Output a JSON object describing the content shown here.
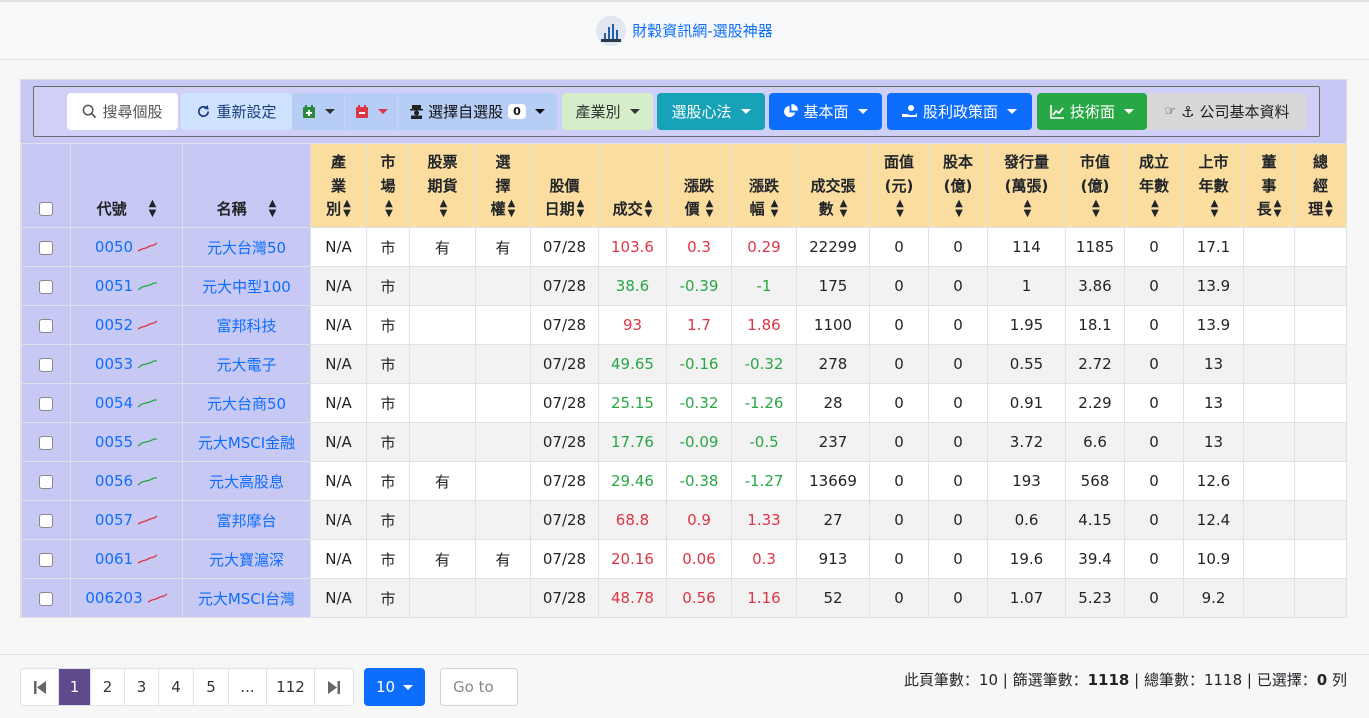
{
  "app": {
    "title": "財穀資訊網-選股神器"
  },
  "colors": {
    "accent": "#0d6efd",
    "up": "#dc3545",
    "down": "#28a745",
    "header_bg": "#fbdd9f",
    "side_bg": "#c8c8f5"
  },
  "toolbar": {
    "search": "搜尋個股",
    "reset": "重新設定",
    "select_watchlist": "選擇自選股",
    "watchlist_count": "0",
    "industry": "產業別",
    "method": "選股心法",
    "fundamentals": "基本面",
    "dividend": "股利政策面",
    "technical": "技術面",
    "company_info": "公司基本資料"
  },
  "columns": [
    {
      "key": "code",
      "label": "代號"
    },
    {
      "key": "name",
      "label": "名稱"
    },
    {
      "key": "industry",
      "label": "產業別"
    },
    {
      "key": "market",
      "label": "市場"
    },
    {
      "key": "futures",
      "label": "股票期貨"
    },
    {
      "key": "options",
      "label": "選擇權"
    },
    {
      "key": "date",
      "label": "股價日期"
    },
    {
      "key": "price",
      "label": "成交"
    },
    {
      "key": "change",
      "label": "漲跌價"
    },
    {
      "key": "pct",
      "label": "漲跌幅"
    },
    {
      "key": "volume",
      "label": "成交張數"
    },
    {
      "key": "par",
      "label": "面值(元)"
    },
    {
      "key": "capital",
      "label": "股本(億)"
    },
    {
      "key": "issued",
      "label": "發行量(萬張)"
    },
    {
      "key": "mcap",
      "label": "市值(億)"
    },
    {
      "key": "est_years",
      "label": "成立年數"
    },
    {
      "key": "list_years",
      "label": "上市年數"
    },
    {
      "key": "chair",
      "label": "董事長"
    },
    {
      "key": "gm",
      "label": "總經理"
    }
  ],
  "rows": [
    {
      "code": "0050",
      "name": "元大台灣50",
      "industry": "N/A",
      "market": "市",
      "futures": "有",
      "options": "有",
      "date": "07/28",
      "price": "103.6",
      "change": "0.3",
      "pct": "0.29",
      "volume": "22299",
      "par": "0",
      "capital": "0",
      "issued": "114",
      "mcap": "1185",
      "est_years": "0",
      "list_years": "17.1",
      "chair": "",
      "gm": "",
      "dir": "up"
    },
    {
      "code": "0051",
      "name": "元大中型100",
      "industry": "N/A",
      "market": "市",
      "futures": "",
      "options": "",
      "date": "07/28",
      "price": "38.6",
      "change": "-0.39",
      "pct": "-1",
      "volume": "175",
      "par": "0",
      "capital": "0",
      "issued": "1",
      "mcap": "3.86",
      "est_years": "0",
      "list_years": "13.9",
      "chair": "",
      "gm": "",
      "dir": "down"
    },
    {
      "code": "0052",
      "name": "富邦科技",
      "industry": "N/A",
      "market": "市",
      "futures": "",
      "options": "",
      "date": "07/28",
      "price": "93",
      "change": "1.7",
      "pct": "1.86",
      "volume": "1100",
      "par": "0",
      "capital": "0",
      "issued": "1.95",
      "mcap": "18.1",
      "est_years": "0",
      "list_years": "13.9",
      "chair": "",
      "gm": "",
      "dir": "up"
    },
    {
      "code": "0053",
      "name": "元大電子",
      "industry": "N/A",
      "market": "市",
      "futures": "",
      "options": "",
      "date": "07/28",
      "price": "49.65",
      "change": "-0.16",
      "pct": "-0.32",
      "volume": "278",
      "par": "0",
      "capital": "0",
      "issued": "0.55",
      "mcap": "2.72",
      "est_years": "0",
      "list_years": "13",
      "chair": "",
      "gm": "",
      "dir": "down"
    },
    {
      "code": "0054",
      "name": "元大台商50",
      "industry": "N/A",
      "market": "市",
      "futures": "",
      "options": "",
      "date": "07/28",
      "price": "25.15",
      "change": "-0.32",
      "pct": "-1.26",
      "volume": "28",
      "par": "0",
      "capital": "0",
      "issued": "0.91",
      "mcap": "2.29",
      "est_years": "0",
      "list_years": "13",
      "chair": "",
      "gm": "",
      "dir": "down"
    },
    {
      "code": "0055",
      "name": "元大MSCI金融",
      "industry": "N/A",
      "market": "市",
      "futures": "",
      "options": "",
      "date": "07/28",
      "price": "17.76",
      "change": "-0.09",
      "pct": "-0.5",
      "volume": "237",
      "par": "0",
      "capital": "0",
      "issued": "3.72",
      "mcap": "6.6",
      "est_years": "0",
      "list_years": "13",
      "chair": "",
      "gm": "",
      "dir": "down"
    },
    {
      "code": "0056",
      "name": "元大高股息",
      "industry": "N/A",
      "market": "市",
      "futures": "有",
      "options": "",
      "date": "07/28",
      "price": "29.46",
      "change": "-0.38",
      "pct": "-1.27",
      "volume": "13669",
      "par": "0",
      "capital": "0",
      "issued": "193",
      "mcap": "568",
      "est_years": "0",
      "list_years": "12.6",
      "chair": "",
      "gm": "",
      "dir": "down"
    },
    {
      "code": "0057",
      "name": "富邦摩台",
      "industry": "N/A",
      "market": "市",
      "futures": "",
      "options": "",
      "date": "07/28",
      "price": "68.8",
      "change": "0.9",
      "pct": "1.33",
      "volume": "27",
      "par": "0",
      "capital": "0",
      "issued": "0.6",
      "mcap": "4.15",
      "est_years": "0",
      "list_years": "12.4",
      "chair": "",
      "gm": "",
      "dir": "up"
    },
    {
      "code": "0061",
      "name": "元大寶滬深",
      "industry": "N/A",
      "market": "市",
      "futures": "有",
      "options": "有",
      "date": "07/28",
      "price": "20.16",
      "change": "0.06",
      "pct": "0.3",
      "volume": "913",
      "par": "0",
      "capital": "0",
      "issued": "19.6",
      "mcap": "39.4",
      "est_years": "0",
      "list_years": "10.9",
      "chair": "",
      "gm": "",
      "dir": "up"
    },
    {
      "code": "006203",
      "name": "元大MSCI台灣",
      "industry": "N/A",
      "market": "市",
      "futures": "",
      "options": "",
      "date": "07/28",
      "price": "48.78",
      "change": "0.56",
      "pct": "1.16",
      "volume": "52",
      "par": "0",
      "capital": "0",
      "issued": "1.07",
      "mcap": "5.23",
      "est_years": "0",
      "list_years": "9.2",
      "chair": "",
      "gm": "",
      "dir": "up"
    }
  ],
  "pagination": {
    "pages": [
      "1",
      "2",
      "3",
      "4",
      "5",
      "...",
      "112"
    ],
    "current": "1",
    "page_size": "10",
    "goto_placeholder": "Go to"
  },
  "stats": {
    "page_count_label": "此頁筆數：",
    "page_count": "10",
    "filter_label": "篩選筆數：",
    "filter_count": "1118",
    "total_label": "總筆數：",
    "total_count": "1118",
    "selected_label": "已選擇：",
    "selected_count": "0",
    "selected_unit": "列"
  }
}
